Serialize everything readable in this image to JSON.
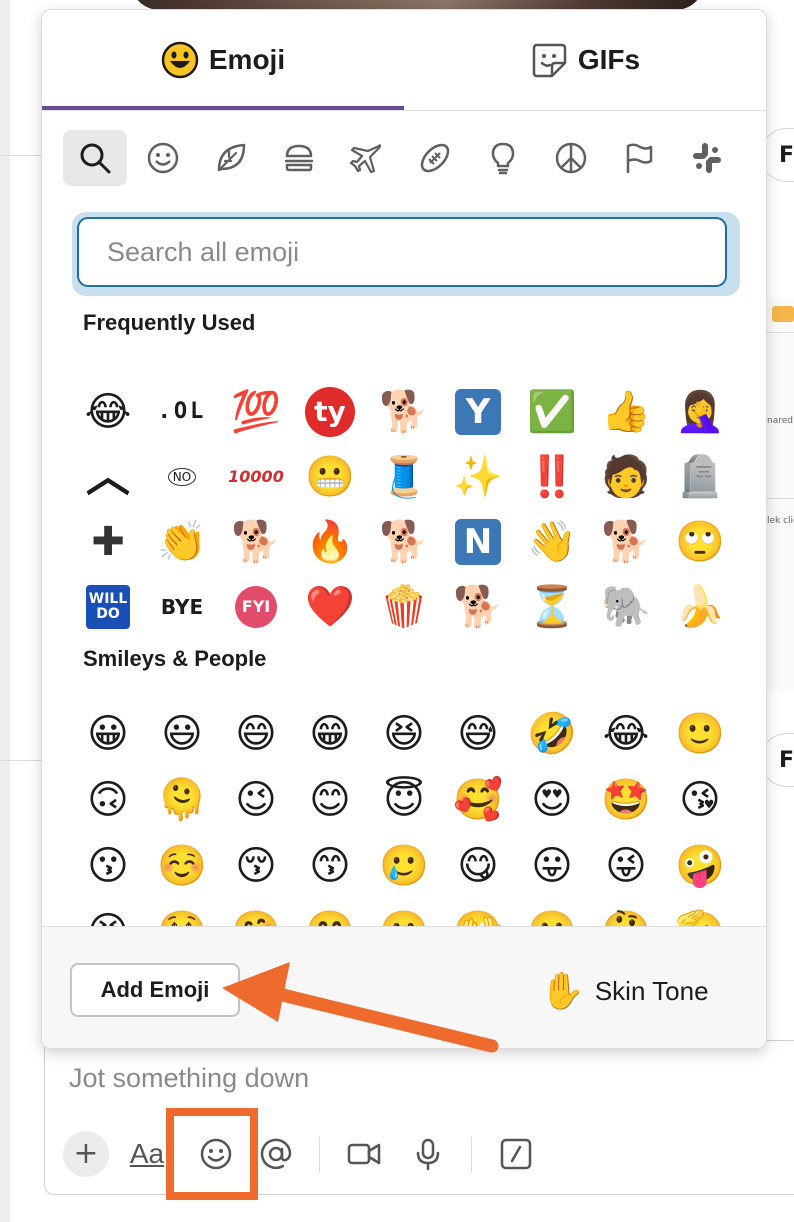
{
  "background": {
    "right_chip_letter": "F",
    "right_panel_text_1": "nared",
    "right_panel_text_2": "lek clic"
  },
  "picker": {
    "tabs": [
      {
        "label": "Emoji",
        "icon": "smiley-face-icon"
      },
      {
        "label": "GIFs",
        "icon": "gif-sticker-icon"
      }
    ],
    "categories": [
      "search-icon",
      "smileys-icon",
      "nature-leaf-icon",
      "food-burger-icon",
      "travel-airplane-icon",
      "activity-football-icon",
      "objects-lightbulb-icon",
      "symbols-peace-icon",
      "flags-icon",
      "slack-icon"
    ],
    "search_placeholder": "Search all emoji",
    "sections": {
      "frequently_used_title": "Frequently Used",
      "smileys_title": "Smileys & People"
    },
    "frequently_used": [
      [
        "😂",
        ".OL",
        "💯",
        "ty",
        "🐕",
        "Y",
        "✅",
        "👍",
        "🤦‍♀️"
      ],
      [
        "︿",
        "NO",
        "10000",
        "😬",
        "🧵",
        "✨",
        "‼️",
        "🧑",
        "🪦"
      ],
      [
        "✚",
        "👏",
        "🐕",
        "🔥",
        "🐕",
        "N",
        "👋",
        "🐕",
        "🙄"
      ],
      [
        "WILL DO",
        "BYE",
        "FYI",
        "❤️",
        "🍿",
        "🐕",
        "⏳",
        "🐘",
        "🍌"
      ]
    ],
    "smileys": [
      [
        "😀",
        "😃",
        "😄",
        "😁",
        "😆",
        "😅",
        "🤣",
        "😂",
        "🙂"
      ],
      [
        "🙃",
        "🫠",
        "😉",
        "😊",
        "😇",
        "🥰",
        "😍",
        "🤩",
        "😘"
      ],
      [
        "😗",
        "☺️",
        "😚",
        "😙",
        "🥲",
        "😋",
        "😛",
        "😜",
        "🤪"
      ],
      [
        "😝",
        "🤑",
        "🤗",
        "🤭",
        "🫢",
        "🫣",
        "🤫",
        "🤔",
        "🫡"
      ]
    ],
    "footer": {
      "add_emoji_label": "Add Emoji",
      "skin_tone_label": "Skin Tone",
      "skin_tone_icon": "✋"
    }
  },
  "composer": {
    "placeholder": "Jot something down",
    "format_label": "Aa"
  },
  "colors": {
    "accent_purple": "#6b4c92",
    "annotation_orange": "#ee6b2d",
    "search_border": "#1d6fa5"
  }
}
